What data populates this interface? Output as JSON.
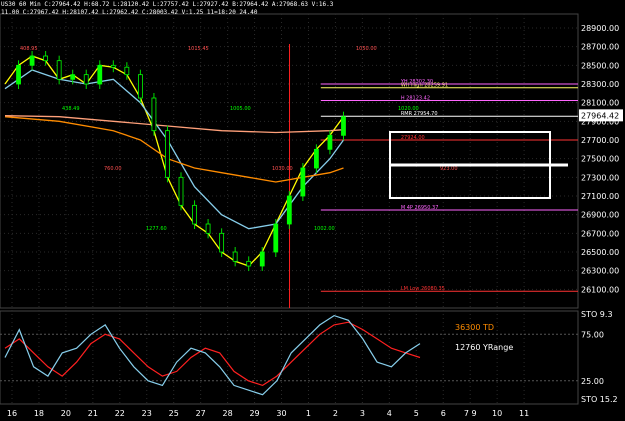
{
  "header": {
    "line1": "US30 60 Min  C:27964.42  H:68.72  L:28120.42  L:27757.42  L:27927.42  B:27964.42  A:27968.63  V:16.3",
    "line2": "11.00 C:27967.42  H:28107.42  L:27962.42  C:28003.42  V:1.25  11=18:20  24.40"
  },
  "chart_data": [
    {
      "type": "line",
      "name": "price-panel",
      "ylim": [
        25900,
        29050
      ],
      "y_ticks": [
        26100,
        26300,
        26500,
        26700,
        26900,
        27100,
        27300,
        27500,
        27700,
        27900,
        28100,
        28300,
        28500,
        28700,
        28900
      ],
      "y_tick_labels": [
        "26100.00",
        "26300.00",
        "26500.00",
        "26700.00",
        "26900.00",
        "27100.00",
        "27300.00",
        "27500.00",
        "27700.00",
        "27900.00",
        "28100.00",
        "28300.00",
        "28500.00",
        "28700.00",
        "28900.00"
      ],
      "current_price": 27964,
      "current_price_label": "27964.42",
      "x_categories": [
        "16",
        "18",
        "20",
        "21",
        "22",
        "23",
        "25",
        "27",
        "28",
        "29",
        "30",
        "1",
        "2",
        "3",
        "4",
        "5",
        "6",
        "7",
        "9",
        "10",
        "11"
      ],
      "x_tick_labels": [
        "16",
        "18",
        "20",
        "21",
        "22",
        "23",
        "25",
        "27",
        "28",
        "29",
        "30",
        "1",
        "2",
        "3",
        "4",
        "5",
        "6",
        "7 9",
        "10",
        "11"
      ],
      "series": [
        {
          "name": "",
          "color": "#ffff00",
          "values": [
            [
              0,
              28300
            ],
            [
              1,
              28500
            ],
            [
              2,
              28600
            ],
            [
              3,
              28550
            ],
            [
              4,
              28350
            ],
            [
              5,
              28400
            ],
            [
              6,
              28300
            ],
            [
              7,
              28500
            ],
            [
              8,
              28480
            ],
            [
              9,
              28400
            ],
            [
              10,
              28150
            ],
            [
              11,
              27800
            ],
            [
              12,
              27300
            ],
            [
              13,
              27000
            ],
            [
              14,
              26800
            ],
            [
              15,
              26700
            ],
            [
              16,
              26500
            ],
            [
              17,
              26400
            ],
            [
              18,
              26350
            ],
            [
              19,
              26500
            ],
            [
              20,
              26800
            ],
            [
              21,
              27100
            ],
            [
              22,
              27400
            ],
            [
              23,
              27600
            ],
            [
              24,
              27750
            ],
            [
              25,
              27950
            ]
          ]
        },
        {
          "name": "",
          "color": "#87ceeb",
          "values": [
            [
              0,
              28250
            ],
            [
              2,
              28450
            ],
            [
              4,
              28350
            ],
            [
              6,
              28300
            ],
            [
              8,
              28350
            ],
            [
              10,
              28100
            ],
            [
              12,
              27700
            ],
            [
              14,
              27200
            ],
            [
              16,
              26900
            ],
            [
              18,
              26750
            ],
            [
              20,
              26800
            ],
            [
              22,
              27200
            ],
            [
              24,
              27500
            ],
            [
              25,
              27700
            ]
          ]
        },
        {
          "name": "",
          "color": "#ff8c00",
          "values": [
            [
              0,
              27950
            ],
            [
              4,
              27900
            ],
            [
              8,
              27800
            ],
            [
              10,
              27700
            ],
            [
              12,
              27500
            ],
            [
              14,
              27400
            ],
            [
              16,
              27350
            ],
            [
              18,
              27300
            ],
            [
              20,
              27250
            ],
            [
              22,
              27300
            ],
            [
              24,
              27350
            ],
            [
              25,
              27400
            ]
          ]
        },
        {
          "name": "",
          "color": "#ffa07a",
          "values": [
            [
              0,
              27960
            ],
            [
              4,
              27950
            ],
            [
              8,
              27900
            ],
            [
              12,
              27850
            ],
            [
              16,
              27800
            ],
            [
              20,
              27780
            ],
            [
              24,
              27800
            ],
            [
              25,
              27810
            ]
          ]
        }
      ],
      "levels": [
        {
          "label": "WH High 28259.91",
          "value": 28260,
          "color": "#ffff66",
          "from": 0.78,
          "to": 1.0
        },
        {
          "label": "YH 28302.30",
          "value": 28300,
          "color": "#ff66ff",
          "from": 0.78,
          "to": 1.0
        },
        {
          "label": "H 28123.42",
          "value": 28123,
          "color": "#ff66ff",
          "from": 0.78,
          "to": 1.0
        },
        {
          "label": "RMR 27954.70",
          "value": 27955,
          "color": "#ffffff",
          "from": 0.78,
          "to": 1.0
        },
        {
          "label": "27924.00",
          "value": 27700,
          "color": "#ff3333",
          "from": 0.78,
          "to": 1.0
        },
        {
          "label": "M 4P 26950.37",
          "value": 26950,
          "color": "#ff66ff",
          "from": 0.78,
          "to": 1.0
        },
        {
          "label": "LM Low 26080.35",
          "value": 26080,
          "color": "#ff3333",
          "from": 0.78,
          "to": 1.0
        }
      ],
      "annotations": [
        "408.95",
        "438.49",
        "760.00",
        "1277.60",
        "1015.45",
        "1005.00",
        "1030.00",
        "1002.00",
        "1050.00",
        "1020.00",
        "923.00"
      ]
    },
    {
      "type": "line",
      "name": "stochastic-panel",
      "ylim": [
        0,
        100
      ],
      "y_tick_labels": [
        "STO 9.3",
        "75.00",
        "25.00",
        "STO 15.2"
      ],
      "texts": [
        {
          "text": "36300 TD",
          "color": "#ff8c00"
        },
        {
          "text": "12760 YRange",
          "color": "#ffffff"
        }
      ],
      "series": [
        {
          "name": "",
          "color": "#ff2020",
          "values": [
            60,
            70,
            55,
            40,
            30,
            45,
            65,
            75,
            70,
            55,
            40,
            30,
            35,
            50,
            60,
            55,
            35,
            25,
            20,
            30,
            45,
            60,
            75,
            85,
            88,
            80,
            70,
            60,
            55,
            50
          ]
        },
        {
          "name": "",
          "color": "#87ceeb",
          "values": [
            50,
            80,
            40,
            30,
            55,
            60,
            75,
            85,
            60,
            40,
            25,
            20,
            45,
            60,
            55,
            40,
            20,
            15,
            10,
            25,
            55,
            70,
            85,
            95,
            90,
            70,
            45,
            40,
            55,
            65
          ]
        }
      ]
    }
  ]
}
